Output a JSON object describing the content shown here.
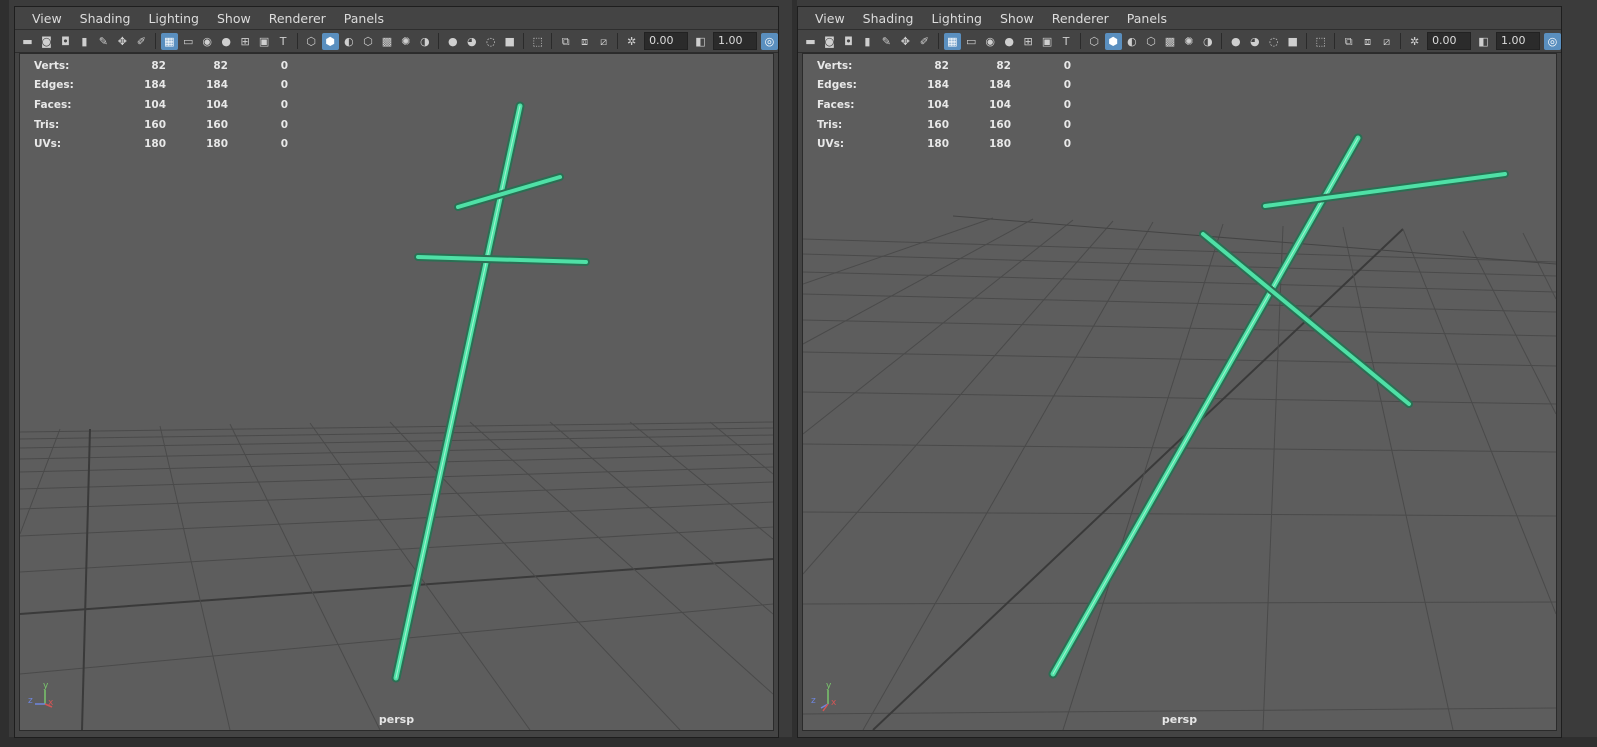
{
  "menu": [
    "View",
    "Shading",
    "Lighting",
    "Show",
    "Renderer",
    "Panels"
  ],
  "toolbar": {
    "exposure": "0.00",
    "gamma": "1.00",
    "icons": [
      "camera-icon",
      "camera-attributes-icon",
      "bookmark-icon",
      "pencil-icon",
      "move-camera-icon",
      "grease-pencil-icon",
      "grid-icon",
      "film-gate-icon",
      "resolution-gate-icon",
      "gate-mask-icon",
      "field-chart-icon",
      "safe-action-icon",
      "safe-title-icon",
      "wireframe-icon",
      "smooth-shade-icon",
      "default-material-icon",
      "textured-icon",
      "lights-icon",
      "shadows-icon",
      "ambient-occlusion-icon",
      "motion-blur-icon",
      "anti-alias-icon",
      "depth-of-field-icon",
      "isolate-select-icon",
      "xray-icon",
      "xray-joints-icon",
      "backface-icon",
      "exposure-icon",
      "gamma-icon",
      "color-management-icon"
    ]
  },
  "hud": {
    "rows": [
      {
        "label": "Verts:",
        "a": "82",
        "b": "82",
        "c": "0"
      },
      {
        "label": "Edges:",
        "a": "184",
        "b": "184",
        "c": "0"
      },
      {
        "label": "Faces:",
        "a": "104",
        "b": "104",
        "c": "0"
      },
      {
        "label": "Tris:",
        "a": "160",
        "b": "160",
        "c": "0"
      },
      {
        "label": "UVs:",
        "a": "180",
        "b": "180",
        "c": "0"
      }
    ]
  },
  "panels": [
    {
      "camera": "persp"
    },
    {
      "camera": "persp"
    }
  ],
  "axis": {
    "x": "x",
    "y": "y",
    "z": "z"
  },
  "colors": {
    "viewport_bg": "#5d5d5d",
    "selection": "#4fe0a6",
    "grid": "#4a4a4a"
  }
}
